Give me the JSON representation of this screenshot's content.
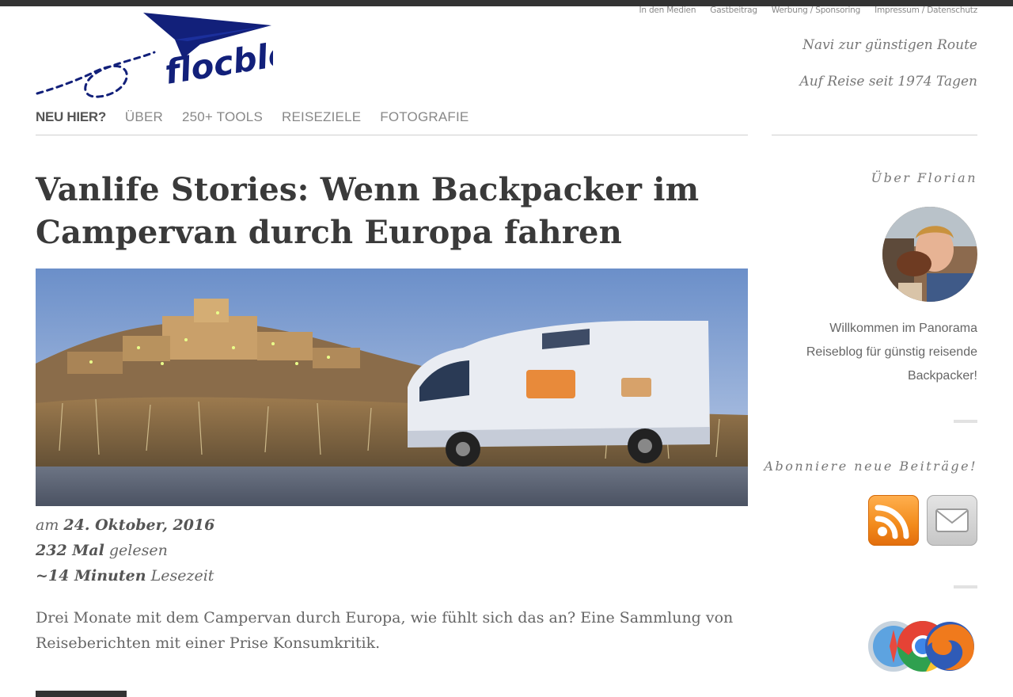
{
  "site": {
    "logo_text": "flocblog",
    "utility_nav": [
      "In den Medien",
      "Gastbeitrag",
      "Werbung / Sponsoring",
      "Impressum / Datenschutz"
    ],
    "tagline_1": "Navi zur günstigen Route",
    "tagline_2": "Auf Reise seit 1974 Tagen",
    "main_nav": [
      "NEU HIER?",
      "ÜBER",
      "250+ TOOLS",
      "REISEZIELE",
      "FOTOGRAFIE"
    ]
  },
  "post": {
    "title": "Vanlife Stories: Wenn Backpacker im Campervan durch Europa fahren",
    "meta_1_prefix": "am",
    "date": "24. Oktober, 2016",
    "views": "232 Mal",
    "views_suffix": "gelesen",
    "reading_time": "~14 Minuten",
    "reading_time_suffix": "Lesezeit",
    "excerpt": "Drei Monate mit dem Campervan durch Europa, wie fühlt sich das an? Eine Sammlung von Reiseberichten mit einer Prise Konsumkritik."
  },
  "sidebar": {
    "about_title": "Über Florian",
    "welcome_text": "Willkommen im Panorama Reiseblog für günstig reisende Backpacker!",
    "subscribe_title": "Abonniere neue Beiträge!",
    "icons": [
      "rss-icon",
      "mail-icon",
      "safari-icon",
      "chrome-icon",
      "firefox-icon"
    ]
  },
  "colors": {
    "logo_blue": "#12207a",
    "rss_orange": "#f28a1b",
    "text_gray": "#666666"
  }
}
